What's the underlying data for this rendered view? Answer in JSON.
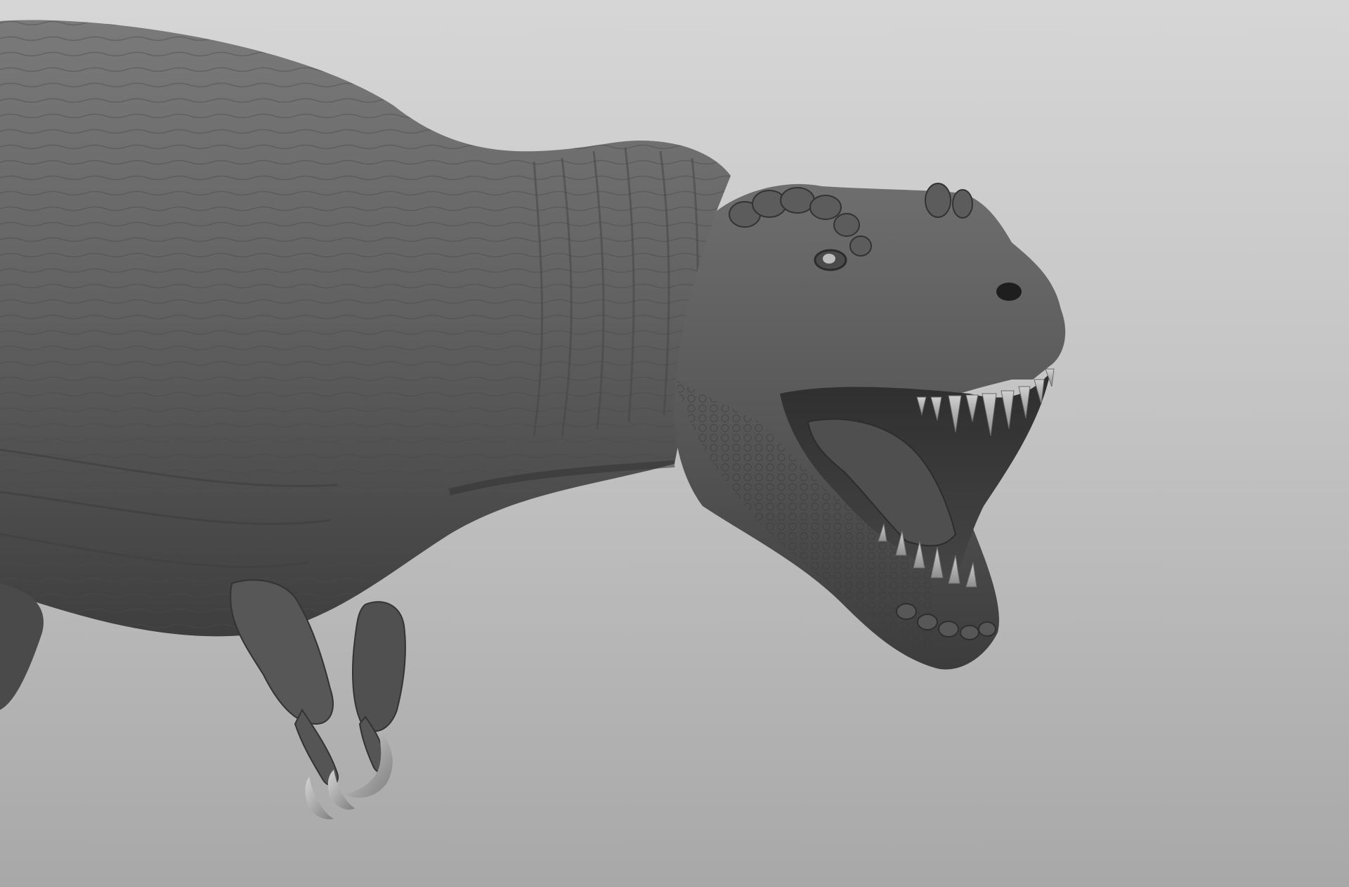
{
  "scene": {
    "subject": "t-rex-sculpt",
    "render_style": "clay-matcap",
    "colors": {
      "background_top": "#d6d6d6",
      "background_bottom": "#a8a8a8",
      "clay_light": "#7a7a7a",
      "clay_mid": "#5a5a5a",
      "clay_dark": "#3a3a3a",
      "teeth": "#bdbdbd"
    }
  }
}
